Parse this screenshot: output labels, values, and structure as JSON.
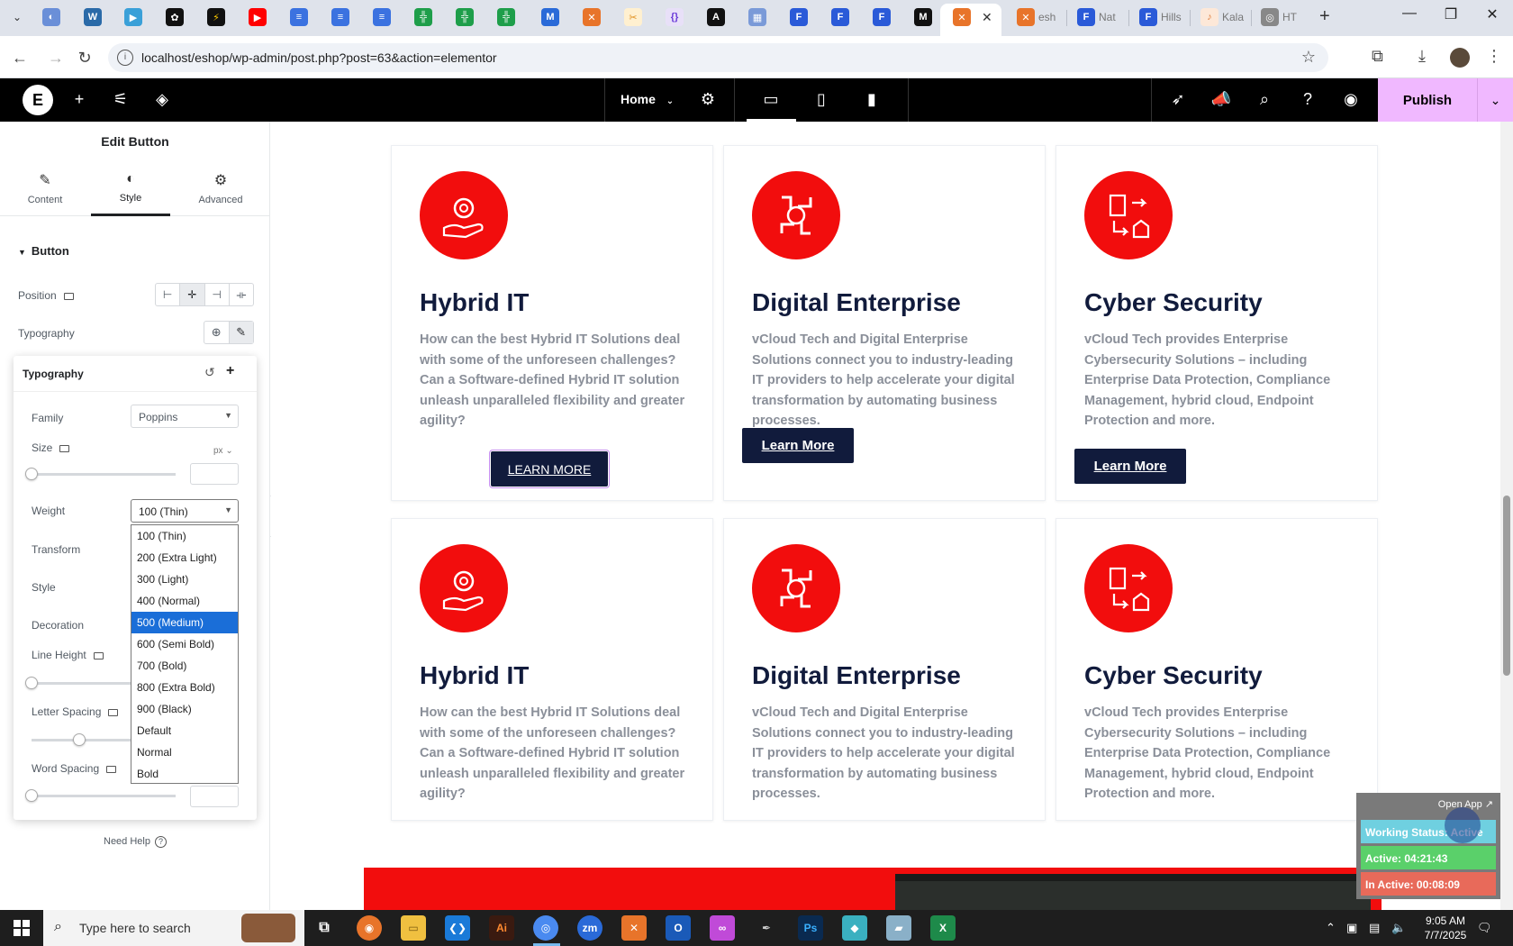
{
  "browser": {
    "url": "localhost/eshop/wp-admin/post.php?post=63&action=elementor",
    "tabs": [
      {
        "label": "esh"
      },
      {
        "label": "Nat"
      },
      {
        "label": "Hills"
      },
      {
        "label": "Kala"
      },
      {
        "label": "HT"
      }
    ]
  },
  "elementor": {
    "page_name": "Home",
    "publish_label": "Publish"
  },
  "panel": {
    "title": "Edit Button",
    "tabs": [
      {
        "label": "Content"
      },
      {
        "label": "Style"
      },
      {
        "label": "Advanced"
      }
    ],
    "section": "Button",
    "position_label": "Position",
    "typography_label": "Typography",
    "need_help": "Need Help"
  },
  "typography": {
    "title": "Typography",
    "family_label": "Family",
    "family_value": "Poppins",
    "size_label": "Size",
    "size_unit": "px",
    "weight_label": "Weight",
    "weight_value": "100 (Thin)",
    "transform_label": "Transform",
    "style_label": "Style",
    "decoration_label": "Decoration",
    "line_height_label": "Line Height",
    "letter_spacing_label": "Letter Spacing",
    "word_spacing_label": "Word Spacing",
    "weight_options": [
      "100 (Thin)",
      "200 (Extra Light)",
      "300 (Light)",
      "400 (Normal)",
      "500 (Medium)",
      "600 (Semi Bold)",
      "700 (Bold)",
      "800 (Extra Bold)",
      "900 (Black)",
      "Default",
      "Normal",
      "Bold"
    ],
    "weight_highlighted": "500 (Medium)"
  },
  "cards": [
    {
      "title": "Hybrid IT",
      "text": "How can the best Hybrid IT Solutions deal with some of the unforeseen challenges? Can a Software-defined Hybrid IT solution unleash unparalleled flexibility and greater agility?",
      "button": "LEARN MORE"
    },
    {
      "title": "Digital Enterprise",
      "text": "vCloud Tech and Digital Enterprise Solutions connect you to industry-leading IT providers to help accelerate your digital transformation by automating business processes.",
      "button": "Learn More"
    },
    {
      "title": "Cyber Security",
      "text": "vCloud Tech provides Enterprise Cybersecurity Solutions – including Enterprise Data Protection, Compliance Management, hybrid cloud, Endpoint Protection and more.",
      "button": "Learn More"
    },
    {
      "title": "Hybrid IT",
      "text": "How can the best Hybrid IT Solutions deal with some of the unforeseen challenges? Can a Software-defined Hybrid IT solution unleash unparalleled flexibility and greater agility?"
    },
    {
      "title": "Digital Enterprise",
      "text": "vCloud Tech and Digital Enterprise Solutions connect you to industry-leading IT providers to help accelerate your digital transformation by automating business processes."
    },
    {
      "title": "Cyber Security",
      "text": "vCloud Tech provides Enterprise Cybersecurity Solutions – including Enterprise Data Protection, Compliance Management, hybrid cloud, Endpoint Protection and more."
    }
  ],
  "working_status": {
    "open_app": "Open App ↗",
    "status": "Working Status: Active",
    "active": "Active: 04:21:43",
    "inactive": "In Active: 00:08:09"
  },
  "taskbar": {
    "search_placeholder": "Type here to search",
    "time": "9:05 AM",
    "date": "7/7/2025"
  },
  "colors": {
    "accent_red": "#f20d0d",
    "navy": "#111b3c",
    "publish": "#f0b8ff"
  }
}
